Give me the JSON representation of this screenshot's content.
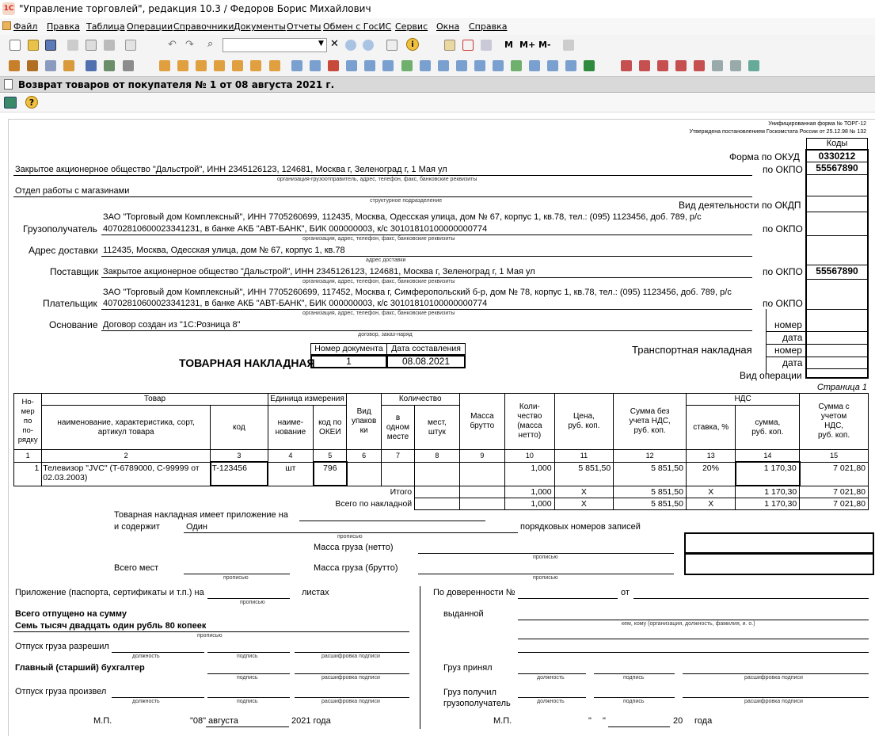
{
  "window": {
    "title": "\"Управление торговлей\", редакция 10.3 / Федоров Борис Михайлович"
  },
  "menu": [
    "Файл",
    "Правка",
    "Таблица",
    "Операции",
    "Справочники",
    "Документы",
    "Отчеты",
    "Обмен с ГосИС",
    "Сервис",
    "Окна",
    "Справка"
  ],
  "toolbar": {
    "m1": "M",
    "m2": "M+",
    "m3": "M-"
  },
  "document": {
    "title": "Возврат товаров от покупателя № 1 от 08 августа 2021 г."
  },
  "form": {
    "unified": "Унифицированная форма № ТОРГ-12",
    "approved": "Утверждена постановлением Госкомстата России от 25.12.98 № 132",
    "codes_header": "Коды",
    "okud_label": "Форма по ОКУД",
    "okud_value": "0330212",
    "okpo_label": "по ОКПО",
    "okpo1_value": "55567890",
    "org_text": "Закрытое акционерное общество \"Дальстрой\", ИНН 2345126123, 124681, Москва г, Зеленоград г, 1 Мая ул",
    "org_caption": "организация-грузоотправитель, адрес, телефон, факс, банковские реквизиты",
    "unit_text": "Отдел работы с магазинами",
    "unit_caption": "структурное подразделение",
    "okdp_label": "Вид деятельности по ОКДП",
    "consignee_label": "Грузополучатель",
    "consignee_line1": "ЗАО \"Торговый дом Комплексный\", ИНН 7705260699, 112435, Москва, Одесская улица, дом № 67, корпус 1, кв.78, тел.: (095) 1123456, доб. 789, р/с",
    "consignee_line2": "40702810600023341231, в банке АКБ \"АВТ-БАНК\", БИК 000000003, к/с 30101810100000000774",
    "consignee_caption": "организация, адрес, телефон, факс, банковские реквизиты",
    "delivery_label": "Адрес доставки",
    "delivery_text": "112435, Москва, Одесская улица, дом № 67, корпус 1, кв.78",
    "delivery_caption": "адрес доставки",
    "supplier_label": "Поставщик",
    "supplier_text": "Закрытое акционерное общество \"Дальстрой\", ИНН 2345126123, 124681, Москва г, Зеленоград г, 1 Мая ул",
    "supplier_caption": "организация, адрес, телефон, факс, банковские реквизиты",
    "okpo3_value": "55567890",
    "payer_label": "Плательщик",
    "payer_line1": "ЗАО \"Торговый дом Комплексный\", ИНН 7705260699, 117452, Москва г, Симферопольский б-р, дом № 78, корпус 1, кв.78, тел.: (095) 1123456, доб. 789, р/с",
    "payer_line2": "40702810600023341231, в банке АКБ \"АВТ-БАНК\", БИК 000000003, к/с 30101810100000000774",
    "payer_caption": "организация, адрес, телефон, факс, банковские реквизиты",
    "basis_label": "Основание",
    "basis_text": "Договор создан из \"1С:Розница 8\"",
    "basis_caption": "договор, заказ-наряд",
    "nomer": "номер",
    "data": "дата",
    "transport_label": "Транспортная накладная",
    "vid_oper": "Вид операции",
    "doc_no_header": "Номер документа",
    "doc_date_header": "Дата составления",
    "doc_no": "1",
    "doc_date": "08.08.2021",
    "waybill_title": "ТОВАРНАЯ НАКЛАДНАЯ",
    "page_label": "Страница 1"
  },
  "table": {
    "h_num": "Но-\nмер\nпо\nпо-\nрядку",
    "h_goods": "Товар",
    "h_unit": "Единица измерения",
    "h_pack": "Вид\nупаков\nки",
    "h_qty": "Количество",
    "h_mass": "Масса\nбрутто",
    "h_qtynet": "Коли-\nчество\n(масса\nнетто)",
    "h_price": "Цена,\nруб. коп.",
    "h_sumnovat": "Сумма без\nучета НДС,\nруб. коп.",
    "h_vat": "НДС",
    "h_total": "Сумма с\nучетом\nНДС,\nруб. коп.",
    "h_name": "наименование, характеристика, сорт,\nартикул товара",
    "h_code": "код",
    "h_uname": "наиме-\nнование",
    "h_okei": "код по\nОКЕИ",
    "h_inone": "в\nодном\nместе",
    "h_places": "мест,\nштук",
    "h_rate": "ставка, %",
    "h_vatsum": "сумма,\nруб. коп.",
    "nums": [
      "1",
      "2",
      "3",
      "4",
      "5",
      "6",
      "7",
      "8",
      "9",
      "10",
      "11",
      "12",
      "13",
      "14",
      "15"
    ],
    "row": {
      "n": "1",
      "name": "Телевизор \"JVC\" (T-6789000, C-99999 от 02.03.2003)",
      "code": "T-123456",
      "unit": "шт",
      "okei": "796",
      "qty": "1,000",
      "price": "5 851,50",
      "sum": "5 851,50",
      "rate": "20%",
      "vat": "1 170,30",
      "total": "7 021,80"
    },
    "itogo_label": "Итого",
    "itogo": {
      "qty": "1,000",
      "price": "X",
      "sum": "5 851,50",
      "rate": "X",
      "vat": "1 170,30",
      "total": "7 021,80"
    },
    "vsego_label": "Всего по накладной",
    "vsego": {
      "qty": "1,000",
      "price": "X",
      "sum": "5 851,50",
      "rate": "X",
      "vat": "1 170,30",
      "total": "7 021,80"
    }
  },
  "footer": {
    "prilozh": "Товарная накладная имеет приложение на",
    "soderzhit": "и содержит",
    "soderzhit_val": "Один",
    "poryadk": "порядковых номеров записей",
    "propisyu": "прописью",
    "mass_net": "Масса груза (нетто)",
    "mass_brut": "Масса груза (брутто)",
    "vsego_mest": "Всего мест",
    "prilozh2": "Приложение (паспорта, сертификаты и т.п.) на",
    "listah": "листах",
    "vsego_otp": "Всего отпущено  на сумму",
    "sum_words": "Семь тысяч двадцать один рубль 80 копеек",
    "otpusk_razr": "Отпуск груза разрешил",
    "glav_buh": "Главный (старший) бухгалтер",
    "otpusk_proizv": "Отпуск груза произвел",
    "dolzhnost": "должность",
    "podpis": "подпись",
    "rassh": "расшифровка подписи",
    "mp": "М.П.",
    "day": "\"08\"",
    "month": "августа",
    "year": "2021 года",
    "doverennost": "По доверенности №",
    "ot": "от",
    "vydannoy": "выданной",
    "kem": "кем, кому (организация, должность, фамилия, и. о.)",
    "gruz_prinyal": "Груз принял",
    "gruz_poluchil": "Груз получил\nгрузополучатель",
    "mp2": "М.П.",
    "q1": "\"",
    "q2": "\"",
    "y20": "20",
    "goda": "года"
  }
}
